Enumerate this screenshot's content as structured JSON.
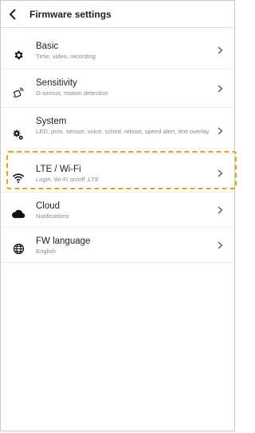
{
  "header": {
    "title": "Firmware settings"
  },
  "rows": [
    {
      "name": "Basic",
      "sub": "Time, video, recording",
      "icon": "gear-icon"
    },
    {
      "name": "Sensitivity",
      "sub": "G-sensor, motion detection",
      "icon": "motion-sensor-icon"
    },
    {
      "name": "System",
      "sub": "LED, prox. sensor, voice, sched. reboot, speed alert, text overlay",
      "icon": "gears-icon"
    },
    {
      "name": "LTE / Wi-Fi",
      "sub": "Login, Wi-Fi on/off ,LTE",
      "icon": "wifi-icon"
    },
    {
      "name": "Cloud",
      "sub": "Notifications",
      "icon": "cloud-icon"
    },
    {
      "name": "FW language",
      "sub": "English",
      "icon": "globe-icon"
    }
  ],
  "highlight_color": "#e6a11a"
}
